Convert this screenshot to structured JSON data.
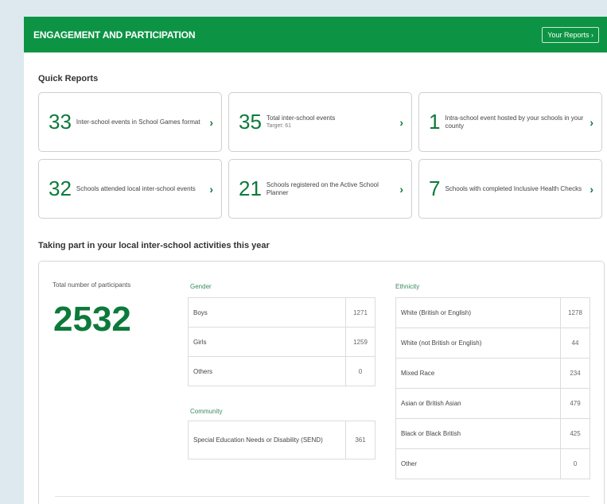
{
  "header": {
    "title": "ENGAGEMENT AND PARTICIPATION",
    "your_reports_label": "Your Reports",
    "your_reports_chevron": "›"
  },
  "quick_reports": {
    "title": "Quick Reports",
    "cards": [
      {
        "number": "33",
        "text": "Inter-school events in School Games format",
        "sub": ""
      },
      {
        "number": "35",
        "text": "Total inter-school events",
        "sub": "Target: 61"
      },
      {
        "number": "1",
        "text": "Intra-school event hosted by your schools in your county",
        "sub": ""
      },
      {
        "number": "32",
        "text": "Schools attended local inter-school events",
        "sub": ""
      },
      {
        "number": "21",
        "text": "Schools registered on the Active School Planner",
        "sub": ""
      },
      {
        "number": "7",
        "text": "Schools with completed Inclusive Health Checks",
        "sub": ""
      }
    ],
    "chevron": "›"
  },
  "taking_part": {
    "title": "Taking part in your local inter-school activities this year",
    "total_label": "Total number of participants",
    "total": "2532",
    "gender": {
      "label": "Gender",
      "rows": [
        {
          "name": "Boys",
          "value": "1271"
        },
        {
          "name": "Girls",
          "value": "1259"
        },
        {
          "name": "Others",
          "value": "0"
        }
      ]
    },
    "community": {
      "label": "Community",
      "rows": [
        {
          "name": "Special Education Needs or Disability (SEND)",
          "value": "361"
        }
      ]
    },
    "ethnicity": {
      "label": "Ethnicity",
      "rows": [
        {
          "name": "White (British or English)",
          "value": "1278"
        },
        {
          "name": "White (not British or English)",
          "value": "44"
        },
        {
          "name": "Mixed Race",
          "value": "234"
        },
        {
          "name": "Asian or British Asian",
          "value": "479"
        },
        {
          "name": "Black or Black British",
          "value": "425"
        },
        {
          "name": "Other",
          "value": "0"
        }
      ]
    }
  },
  "colors": {
    "brand_green": "#0c9444",
    "number_green": "#0c7a3a",
    "page_background": "#dde9ee"
  }
}
